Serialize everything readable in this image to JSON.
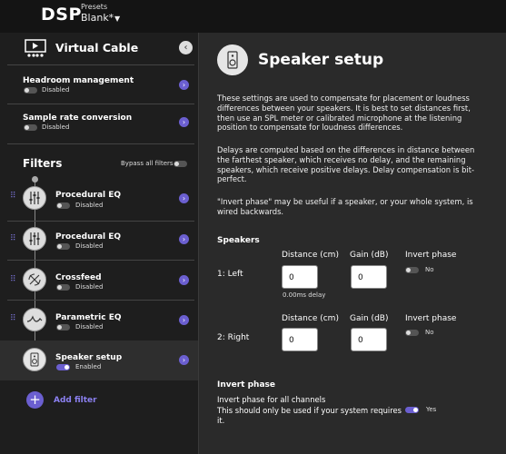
{
  "app": {
    "title": "DSP",
    "presets_label": "Presets",
    "preset_value": "Blank*"
  },
  "sidebar": {
    "virtual_cable": "Virtual Cable",
    "headroom": {
      "title": "Headroom management",
      "status": "Disabled"
    },
    "samplerate": {
      "title": "Sample rate conversion",
      "status": "Disabled"
    },
    "filters_heading": "Filters",
    "bypass_label": "Bypass all filters",
    "filters": [
      {
        "name": "Procedural EQ",
        "status": "Disabled"
      },
      {
        "name": "Procedural EQ",
        "status": "Disabled"
      },
      {
        "name": "Crossfeed",
        "status": "Disabled"
      },
      {
        "name": "Parametric EQ",
        "status": "Disabled"
      },
      {
        "name": "Speaker setup",
        "status": "Enabled"
      }
    ],
    "add_filter": "Add filter"
  },
  "main": {
    "title": "Speaker setup",
    "para1": "These settings are used to compensate for placement or loudness differences between your speakers. It is best to set distances first, then use an SPL meter or calibrated microphone at the listening position to compensate for loudness differences.",
    "para2": "Delays are computed based on the differences in distance between the farthest speaker, which receives no delay, and the remaining speakers, which receive positive delays. Delay compensation is bit-perfect.",
    "para3": "\"Invert phase\" may be useful if a speaker, or your whole system, is wired backwards.",
    "speakers_heading": "Speakers",
    "col_distance": "Distance (cm)",
    "col_gain": "Gain (dB)",
    "col_invert": "Invert phase",
    "speakers": [
      {
        "name": "1: Left",
        "distance": "0",
        "gain": "0",
        "invert": "No",
        "delay": "0.00ms delay"
      },
      {
        "name": "2: Right",
        "distance": "0",
        "gain": "0",
        "invert": "No"
      }
    ],
    "invert_heading": "Invert phase",
    "invert_all": "Invert phase for all channels",
    "invert_note": "This should only be used if your system requires it.",
    "invert_value": "Yes"
  },
  "colors": {
    "accent": "#6b5fd0",
    "sidebar_bg": "#1e1e1e",
    "main_bg": "#2a2a2a"
  }
}
